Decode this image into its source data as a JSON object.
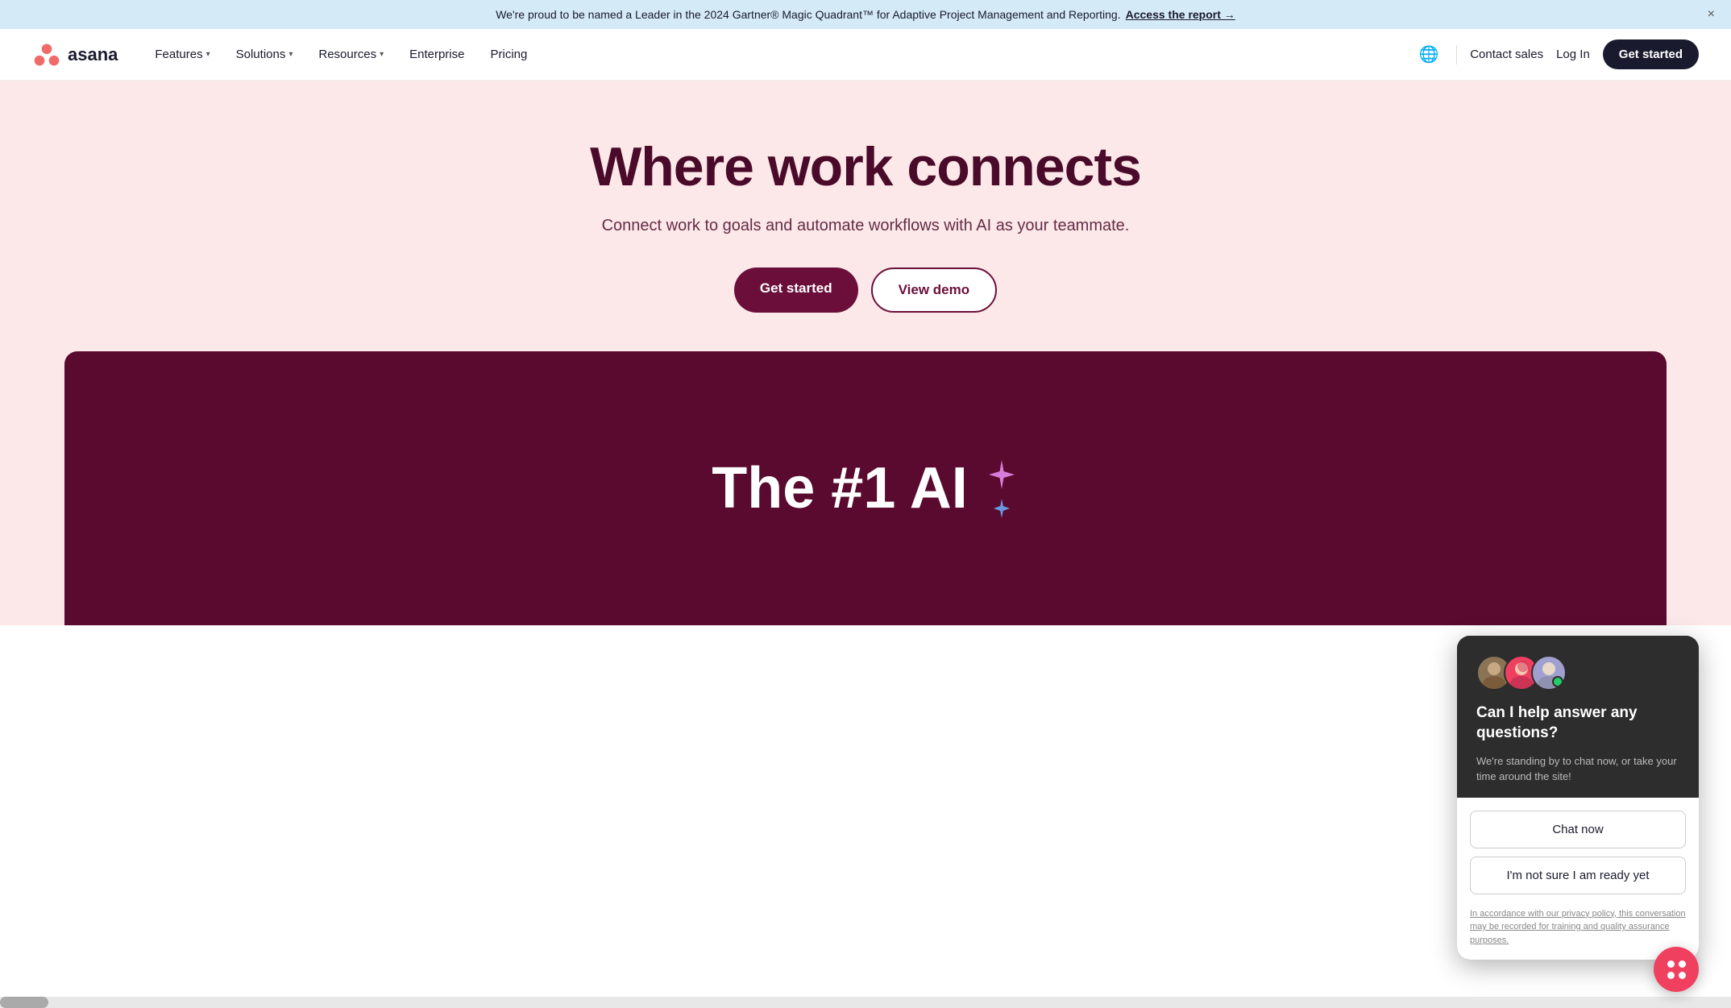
{
  "banner": {
    "text": "We're proud to be named a Leader in the 2024 Gartner® Magic Quadrant™ for Adaptive Project Management and Reporting.",
    "link_text": "Access the report →",
    "close_label": "×"
  },
  "nav": {
    "logo_text": "asana",
    "features_label": "Features",
    "solutions_label": "Solutions",
    "resources_label": "Resources",
    "enterprise_label": "Enterprise",
    "pricing_label": "Pricing",
    "contact_sales_label": "Contact sales",
    "login_label": "Log In",
    "get_started_label": "Get started"
  },
  "hero": {
    "title": "Where work connects",
    "subtitle": "Connect work to goals and automate workflows with AI as your teammate.",
    "get_started_label": "Get started",
    "view_demo_label": "View demo",
    "video_text": "The #1 AI"
  },
  "chat_widget": {
    "title": "Can I help answer any questions?",
    "subtitle": "We're standing by to chat now, or take your time around the site!",
    "chat_now_label": "Chat now",
    "not_ready_label": "I'm not sure I am ready yet",
    "privacy_text": "In accordance with our privacy policy, this conversation may be recorded for training and quality assurance purposes."
  }
}
